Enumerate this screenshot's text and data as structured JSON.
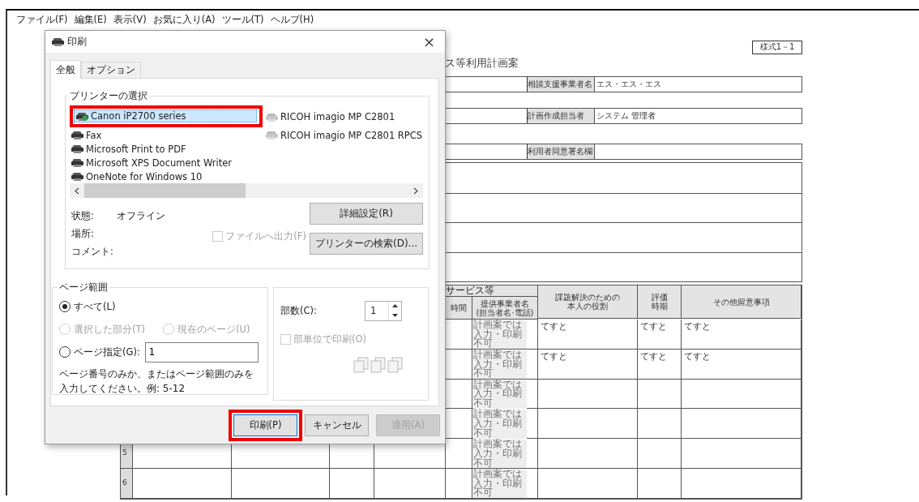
{
  "menu_bar": [
    "ファイル(F)",
    "編集(E)",
    "表示(V)",
    "お気に入り(A)",
    "ツール(T)",
    "ヘルプ(H)"
  ],
  "document": {
    "form_number": "様式1－1",
    "title": "ス等利用計画案",
    "info_rows": [
      {
        "label": "相談支援事業者名",
        "value": "エス・エス・エス"
      },
      {
        "label": "計画作成担当者",
        "value": "システム 管理者"
      },
      {
        "label": "利用者同意署名欄"
      }
    ],
    "table": {
      "group_header": "サービス等",
      "columns": [
        [
          "時間"
        ],
        [
          "提供事業者名",
          "(担当者名·電話)"
        ],
        [
          "課題解決のための",
          "本人の役割"
        ],
        [
          "評価",
          "時期"
        ],
        [
          "その他留意事項"
        ]
      ],
      "rows": [
        {
          "provider": "計画案では入力・印刷不可",
          "role": "てすと",
          "evaluation": "てすと",
          "notes": "てすと"
        },
        {
          "provider": "計画案では入力・印刷不可",
          "role": "てすと",
          "evaluation": "てすと",
          "notes": "てすと"
        },
        {
          "provider": "計画案では入力・印刷不可"
        },
        {
          "provider": "計画案では入力・印刷不可"
        },
        {
          "number": "5",
          "provider": "計画案では入力・印刷不可"
        },
        {
          "number": "6",
          "provider": "計画案では入力・印刷不可"
        }
      ]
    }
  },
  "dialog": {
    "title": "印刷",
    "close": "×",
    "tabs": [
      {
        "label": "全般",
        "selected": true
      },
      {
        "label": "オプション",
        "selected": false
      }
    ],
    "printer_group": "プリンターの選択",
    "printers": [
      {
        "name": "Canon iP2700 series",
        "kind": "local",
        "selected": true,
        "default": true,
        "highlighted": true
      },
      {
        "name": "Fax",
        "kind": "local",
        "selected": false,
        "default": false,
        "highlighted": false
      },
      {
        "name": "Microsoft Print to PDF",
        "kind": "local",
        "selected": false,
        "default": false,
        "highlighted": false
      },
      {
        "name": "Microsoft XPS Document Writer",
        "kind": "local",
        "selected": false,
        "default": false,
        "highlighted": false
      },
      {
        "name": "OneNote for Windows 10",
        "kind": "local",
        "selected": false,
        "default": false,
        "highlighted": false
      },
      {
        "name": "RICOH imagio MP C2801",
        "kind": "network",
        "selected": false,
        "default": false,
        "highlighted": false
      },
      {
        "name": "RICOH imagio MP C2801 RPCS",
        "kind": "network",
        "selected": false,
        "default": false,
        "highlighted": false
      }
    ],
    "status": [
      {
        "label": "状態:",
        "value": "オフライン"
      },
      {
        "label": "場所:"
      },
      {
        "label": "コメント:"
      }
    ],
    "print_to_file": {
      "label": "ファイルへ出力(F)",
      "checked": false,
      "disabled": true
    },
    "printer_buttons": [
      "詳細設定(R)",
      "プリンターの検索(D)..."
    ],
    "page_range": {
      "title": "ページ範囲",
      "options": [
        {
          "label": "すべて(L)",
          "selected": true,
          "disabled": false
        },
        {
          "label": "選択した部分(T)",
          "selected": false,
          "disabled": true
        },
        {
          "label": "現在のページ(U)",
          "selected": false,
          "disabled": true
        },
        {
          "label": "ページ指定(G):",
          "selected": false,
          "disabled": false
        }
      ],
      "pages_value": "1",
      "hint": "ページ番号のみか、またはページ範囲のみを入力してください。例: 5-12"
    },
    "copies": {
      "label": "部数(C):",
      "value": "1",
      "collate": {
        "label": "部単位で印刷(O)",
        "checked": false,
        "disabled": true
      }
    },
    "buttons": [
      {
        "label": "印刷(P)",
        "default": true,
        "disabled": false,
        "highlighted": true
      },
      {
        "label": "キャンセル",
        "default": false,
        "disabled": false,
        "highlighted": false
      },
      {
        "label": "適用(A)",
        "default": false,
        "disabled": true,
        "highlighted": false
      }
    ]
  }
}
